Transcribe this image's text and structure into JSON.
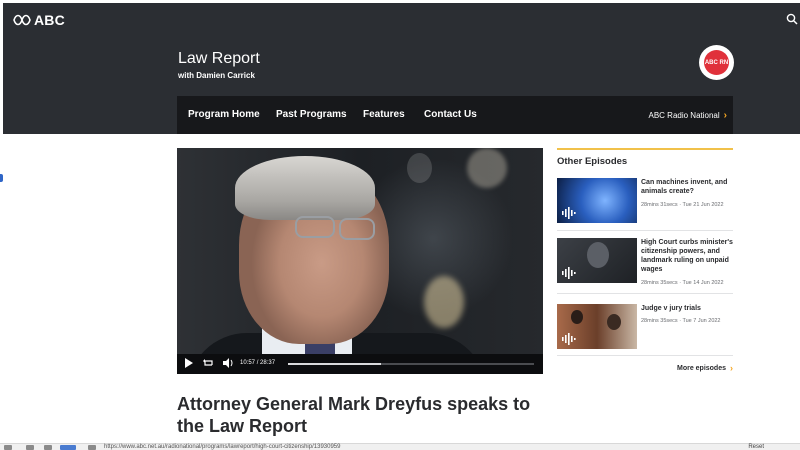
{
  "header": {
    "logo_text": "ABC",
    "program_title": "Law Report",
    "program_subtitle": "with Damien Carrick",
    "badge_text": "ABC RN"
  },
  "nav": {
    "items": [
      "Program Home",
      "Past Programs",
      "Features",
      "Contact Us"
    ],
    "network_link": "ABC Radio National"
  },
  "video": {
    "current_time": "10:57",
    "separator": "/",
    "duration": "28:37",
    "progress_fraction": 0.38
  },
  "episode": {
    "title": "Attorney General Mark Dreyfus speaks to the Law Report"
  },
  "sidebar": {
    "heading": "Other Episodes",
    "episodes": [
      {
        "title": "Can machines invent, and animals create?",
        "meta": "28mins 31secs · Tue 21 Jun 2022"
      },
      {
        "title": "High Court curbs minister's citizenship powers, and landmark ruling on unpaid wages",
        "meta": "28mins 35secs · Tue 14 Jun 2022"
      },
      {
        "title": "Judge v jury trials",
        "meta": "28mins 35secs · Tue 7 Jun 2022"
      }
    ],
    "more_label": "More episodes"
  },
  "statusbar": {
    "url": "https://www.abc.net.au/radionational/programs/lawreport/high-court-citizenship/13930959",
    "right_text": "Reset"
  },
  "colors": {
    "header_bg": "#2b2e33",
    "nav_bg": "#17181b",
    "accent": "#f5a623",
    "rule": "#f1c14a"
  }
}
